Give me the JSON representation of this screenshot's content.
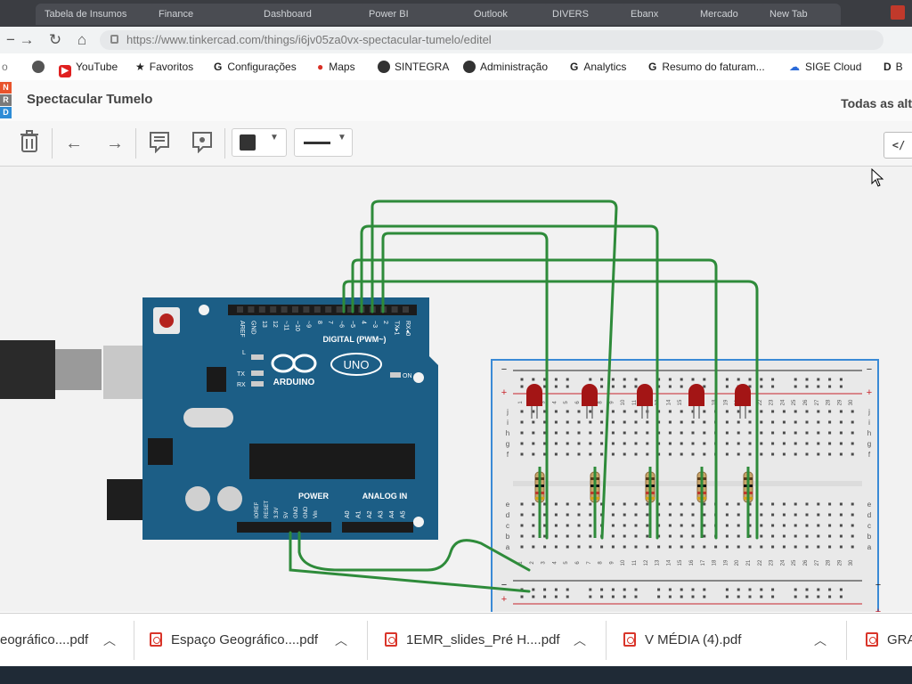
{
  "browser": {
    "tabs": [
      "Tabela de Insumos",
      "Finance",
      "Dashboard",
      "Power BI",
      "Outlook",
      "DIVERS",
      "Ebanx",
      "Mercado",
      "New Tab"
    ],
    "url": "https://www.tinkercad.com/things/i6jv05za0vx-spectacular-tumelo/editel",
    "bookmarks": [
      {
        "label": "YouTube",
        "icon": "youtube-icon"
      },
      {
        "label": "Favoritos",
        "icon": "star-icon"
      },
      {
        "label": "Configurações",
        "icon": "google-icon"
      },
      {
        "label": "Maps",
        "icon": "map-pin-icon"
      },
      {
        "label": "SINTEGRA",
        "icon": "globe-icon"
      },
      {
        "label": "Administração",
        "icon": "globe-icon"
      },
      {
        "label": "Analytics",
        "icon": "google-icon"
      },
      {
        "label": "Resumo do faturam...",
        "icon": "google-icon"
      },
      {
        "label": "SIGE Cloud",
        "icon": "cloud-icon"
      },
      {
        "label": "B",
        "icon": "bookmark-icon"
      }
    ]
  },
  "app": {
    "logo_letters": [
      "N",
      "R",
      "D"
    ],
    "project_title": "Spectacular Tumelo",
    "changes_status": "Todas as alt",
    "code_button": "</"
  },
  "arduino": {
    "brand": "ARDUINO",
    "model": "UNO",
    "digital_label": "DIGITAL (PWM~)",
    "digital_pins": [
      "AREF",
      "GND",
      "13",
      "12",
      "~11",
      "~10",
      "~9",
      "8",
      "7",
      "~6",
      "~5",
      "4",
      "~3",
      "2",
      "TX▸1",
      "RX◂0"
    ],
    "power_label": "POWER",
    "power_pins": [
      "IOREF",
      "RESET",
      "3.3V",
      "5V",
      "GND",
      "GND",
      "Vin"
    ],
    "analog_label": "ANALOG IN",
    "analog_pins": [
      "A0",
      "A1",
      "A2",
      "A3",
      "A4",
      "A5"
    ],
    "led_labels": [
      "L",
      "TX",
      "RX",
      "ON"
    ]
  },
  "breadboard": {
    "rail_minus": "−",
    "rail_plus": "+",
    "row_letters_top": [
      "j",
      "i",
      "h",
      "g",
      "f"
    ],
    "row_letters_bottom": [
      "e",
      "d",
      "c",
      "b",
      "a"
    ],
    "column_numbers": [
      "1",
      "2",
      "3",
      "4",
      "5",
      "6",
      "7",
      "8",
      "9",
      "10",
      "11",
      "12",
      "13",
      "14",
      "15",
      "16",
      "17",
      "18",
      "19",
      "20",
      "21",
      "22",
      "23",
      "24",
      "25",
      "26",
      "27",
      "28",
      "29",
      "30"
    ],
    "led_count": 5,
    "resistor_count": 5,
    "led_color": "#a31515",
    "wire_color": "#2e8b3a"
  },
  "downloads": [
    {
      "label": "eográfico....pdf"
    },
    {
      "label": "Espaço Geográfico....pdf"
    },
    {
      "label": "1EMR_slides_Pré H....pdf"
    },
    {
      "label": "V MÉDIA (4).pdf"
    },
    {
      "label": "GRA"
    }
  ]
}
